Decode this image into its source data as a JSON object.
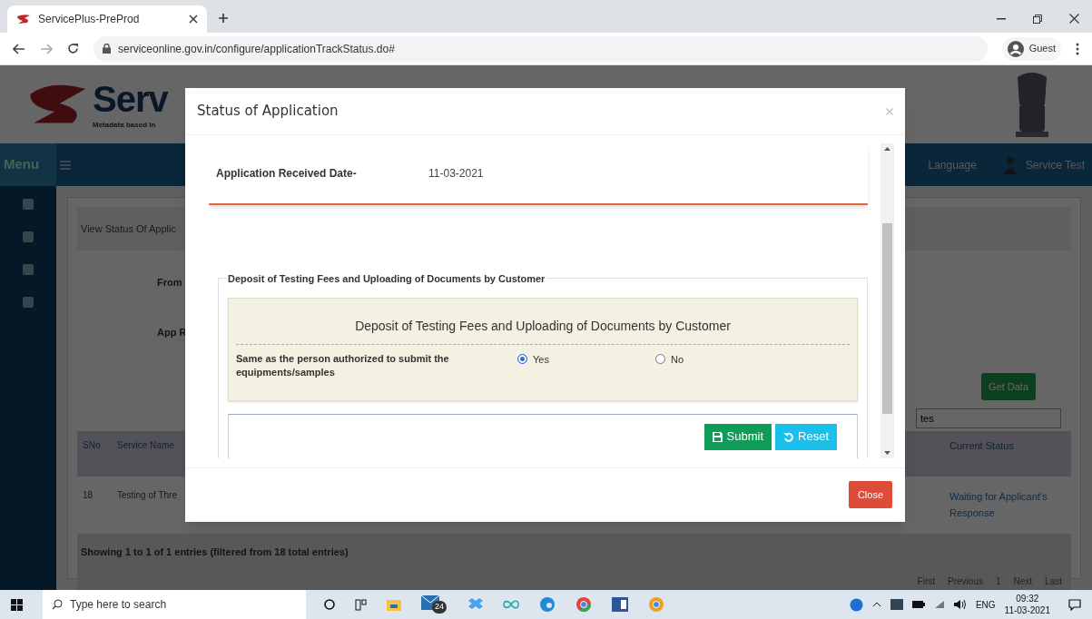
{
  "browser": {
    "tab_title": "ServicePlus-PreProd",
    "url": "serviceonline.gov.in/configure/applicationTrackStatus.do#",
    "profile": "Guest"
  },
  "page": {
    "logo_text": "Serv",
    "logo_subtitle": "Metadata based In",
    "menu_label": "Menu",
    "language": "Language",
    "user": "Service Test",
    "breadcrumb": "View Status Of Applic",
    "form_labels": [
      "From",
      "App R"
    ],
    "get_data": "Get Data",
    "search_value": "tes",
    "columns": [
      "SNo",
      "Service Name",
      "Current Status"
    ],
    "rows": [
      [
        "18",
        "Testing of Thre",
        "Waiting for Applicant's Response"
      ]
    ],
    "info": "Showing 1 to 1 of 1 entries (filtered from 18 total entries)",
    "pagination": [
      "First",
      "Previous",
      "1",
      "Next",
      "Last"
    ]
  },
  "modal": {
    "title": "Status of Application",
    "received_label": "Application Received Date-",
    "received_value": "11-03-2021",
    "legend": "Deposit of Testing Fees and Uploading of Documents by Customer",
    "panel_title": "Deposit of Testing Fees and Uploading of Documents by Customer",
    "question": "Same as the person authorized to submit the equipments/samples",
    "options": [
      {
        "label": "Yes",
        "selected": true
      },
      {
        "label": "No",
        "selected": false
      }
    ],
    "submit": "Submit",
    "reset": "Reset",
    "close": "Close"
  },
  "taskbar": {
    "search_placeholder": "Type here to search",
    "mail_badge": "24",
    "language": "ENG",
    "time": "09:32",
    "date": "11-03-2021"
  }
}
